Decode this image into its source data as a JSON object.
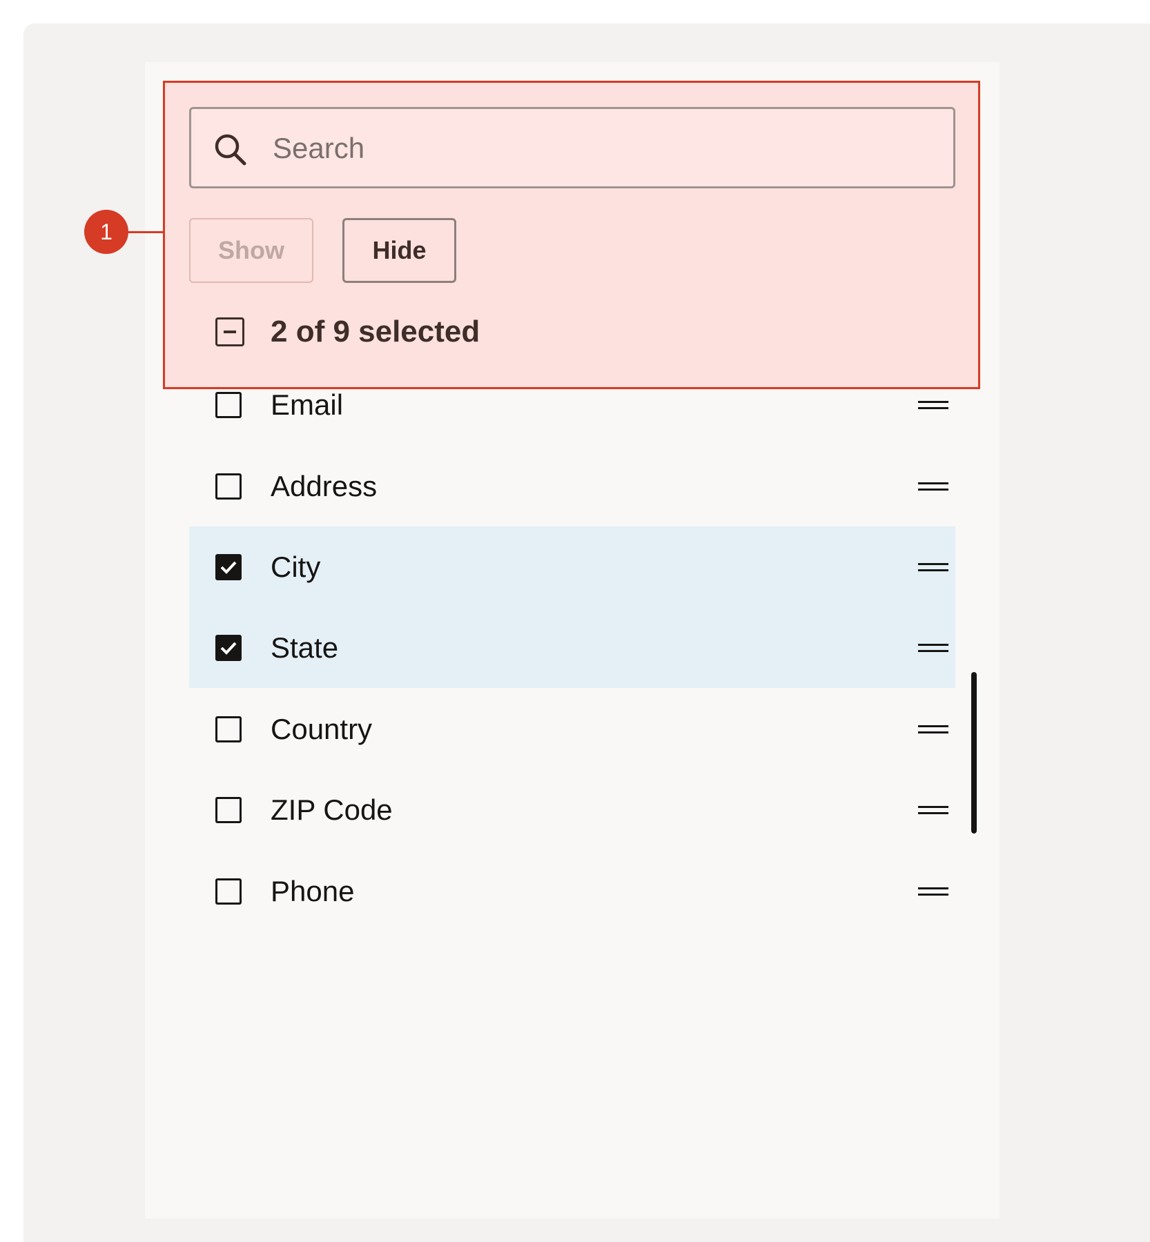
{
  "colors": {
    "highlight_fill": "#fce1de",
    "highlight_border": "#d63b25",
    "selected_row": "#e4f0f6",
    "text": "#161513"
  },
  "search": {
    "placeholder": "Search",
    "value": "",
    "icon": "search-icon"
  },
  "actions": {
    "show_label": "Show",
    "hide_label": "Hide",
    "show_disabled": true
  },
  "selection": {
    "summary": "2 of 9 selected",
    "state": "partial"
  },
  "columns": [
    {
      "label": "Email",
      "checked": false
    },
    {
      "label": "Address",
      "checked": false
    },
    {
      "label": "City",
      "checked": true
    },
    {
      "label": "State",
      "checked": true
    },
    {
      "label": "Country",
      "checked": false
    },
    {
      "label": "ZIP Code",
      "checked": false
    },
    {
      "label": "Phone",
      "checked": false
    }
  ],
  "callout": {
    "number": "1"
  }
}
